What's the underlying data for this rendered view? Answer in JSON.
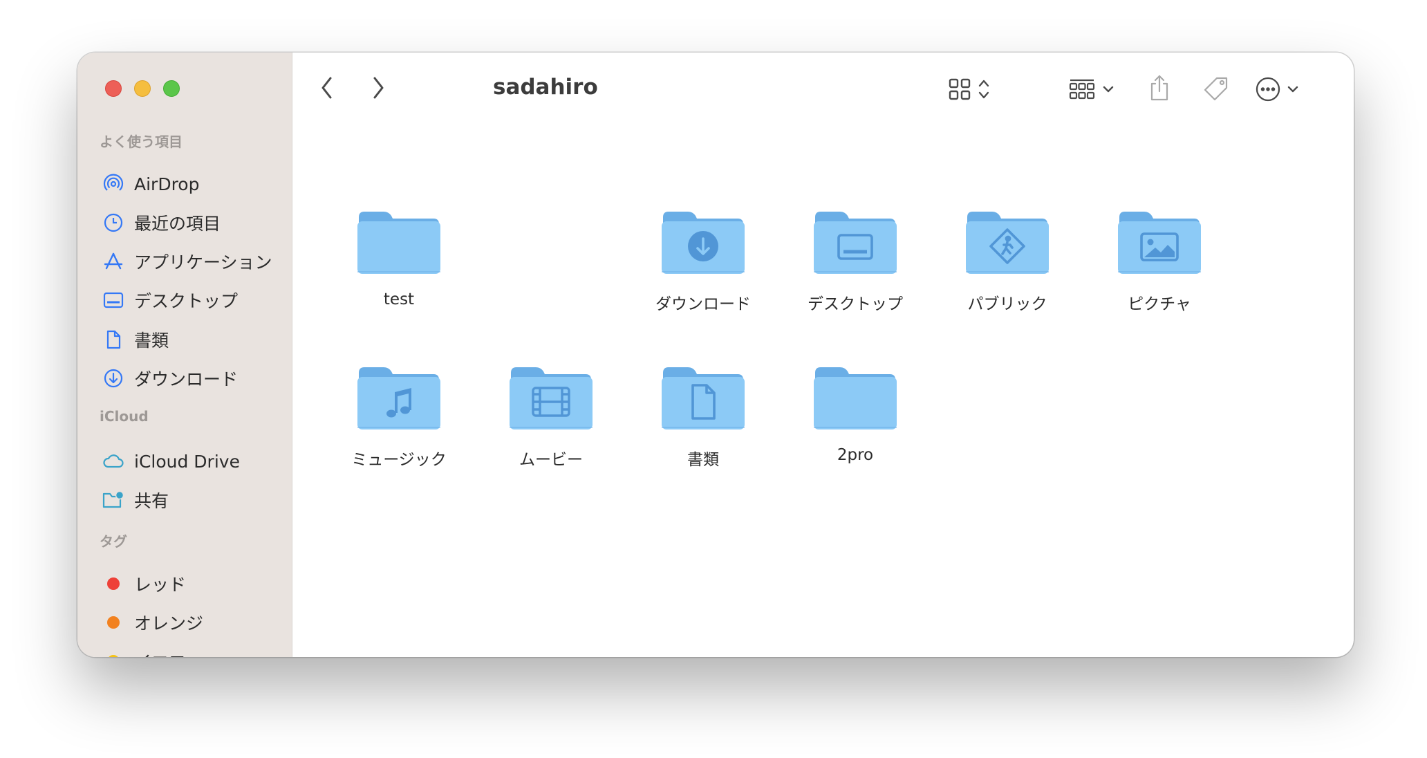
{
  "window": {
    "title": "sadahiro"
  },
  "sidebar": {
    "favorites_title": "よく使う項目",
    "favorites": [
      {
        "label": "AirDrop",
        "icon": "airdrop-icon"
      },
      {
        "label": "最近の項目",
        "icon": "clock-icon"
      },
      {
        "label": "アプリケーション",
        "icon": "applications-icon"
      },
      {
        "label": "デスクトップ",
        "icon": "desktop-icon"
      },
      {
        "label": "書類",
        "icon": "document-icon"
      },
      {
        "label": "ダウンロード",
        "icon": "download-icon"
      }
    ],
    "icloud_title": "iCloud",
    "icloud": [
      {
        "label": "iCloud Drive",
        "icon": "cloud-icon"
      },
      {
        "label": "共有",
        "icon": "shared-folder-icon"
      }
    ],
    "tags_title": "タグ",
    "tags": [
      {
        "label": "レッド",
        "color": "#ee4138"
      },
      {
        "label": "オレンジ",
        "color": "#f2811f"
      },
      {
        "label": "イエロー",
        "color": "#f5c316"
      }
    ]
  },
  "toolbar": {
    "back_icon": "chevron-left-icon",
    "forward_icon": "chevron-right-icon",
    "view_icon": "grid-view-icon",
    "group_icon": "group-icon",
    "share_icon": "share-icon",
    "tag_icon": "tag-icon",
    "action_icon": "ellipsis-circle-icon",
    "search_icon": "search-icon"
  },
  "folders": [
    {
      "name": "test",
      "glyph": "none"
    },
    {
      "name": "ダウンロード",
      "glyph": "download"
    },
    {
      "name": "デスクトップ",
      "glyph": "desktop"
    },
    {
      "name": "パブリック",
      "glyph": "public"
    },
    {
      "name": "ピクチャ",
      "glyph": "picture"
    },
    {
      "name": "ミュージック",
      "glyph": "music"
    },
    {
      "name": "ムービー",
      "glyph": "movie"
    },
    {
      "name": "書類",
      "glyph": "document"
    },
    {
      "name": "2pro",
      "glyph": "none"
    }
  ],
  "colors": {
    "folder": "#8ccaf6",
    "folder_tab": "#6aaee6",
    "glyph": "#5196d6",
    "sidebar_icon": "#3478f6",
    "sidebar_bg": "#e9e3df"
  }
}
